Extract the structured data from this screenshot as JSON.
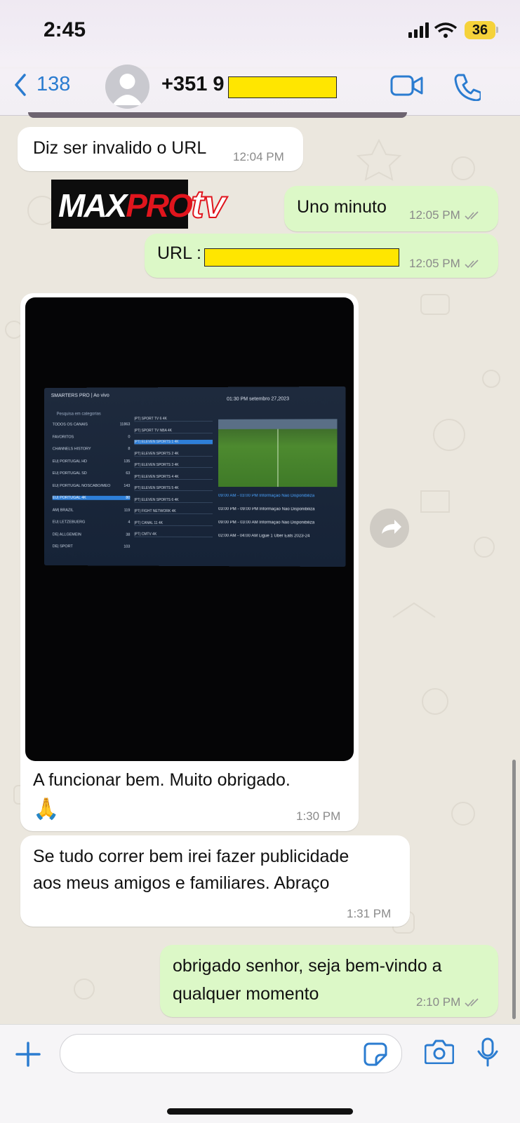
{
  "status_bar": {
    "time": "2:45",
    "battery": "36"
  },
  "header": {
    "back_count": "138",
    "contact": "+351 9"
  },
  "messages": [
    {
      "text": "Diz ser invalido o URL",
      "time": "12:04 PM"
    },
    {
      "text": "Uno minuto",
      "time": "12:05 PM"
    },
    {
      "text": "URL :",
      "time": "12:05 PM"
    },
    {
      "text": "A funcionar bem. Muito obrigado.",
      "emoji": "🙏",
      "time": "1:30 PM"
    },
    {
      "text_line1": "Se tudo correr bem irei fazer publicidade",
      "text_line2": "aos meus amigos e familiares. Abraço",
      "time": "1:31 PM"
    },
    {
      "text_line1": "obrigado senhor, seja bem-vindo a",
      "text_line2": "qualquer momento",
      "time": "2:10 PM"
    }
  ],
  "logo": {
    "brand": "MAXPRO",
    "suffix": "tv"
  },
  "photo_tv": {
    "app_title": "SMARTERS PRO | Ao vivo",
    "clock": "01:30 PM   setembro 27,2023",
    "search": "Pesquisa em categorias",
    "categories": [
      {
        "name": "TODOS OS CANAIS",
        "count": "11863"
      },
      {
        "name": "FAVORITOS",
        "count": "0"
      },
      {
        "name": "CHANNELS HISTORY",
        "count": "8"
      },
      {
        "name": "EU| PORTUGAL HD",
        "count": "135"
      },
      {
        "name": "EU| PORTUGAL SD",
        "count": "63"
      },
      {
        "name": "EU| PORTUGAL NOSCABO/MEO",
        "count": "143"
      },
      {
        "name": "EU| PORTUGAL 4K",
        "count": "80"
      },
      {
        "name": "AM| BRAZIL",
        "count": "119"
      },
      {
        "name": "EU| LETZEBUERG",
        "count": "4"
      },
      {
        "name": "DE| ALLGEMEIN",
        "count": "38"
      },
      {
        "name": "DE| SPORT",
        "count": "103"
      }
    ],
    "channels": [
      "|PT| SPORT TV 6 4K",
      "|PT| SPORT TV NBA 4K",
      "|PT| ELEVEN SPORTS 1 4K",
      "|PT| ELEVEN SPORTS 2 4K",
      "|PT| ELEVEN SPORTS 3 4K",
      "|PT| ELEVEN SPORTS 4 4K",
      "|PT| ELEVEN SPORTS 5 4K",
      "|PT| ELEVEN SPORTS 6 4K",
      "|PT| FIGHT NETWORK 4K",
      "|PT| CANAL 11 4K",
      "|PT| CMTV 4K"
    ],
    "epg": [
      "09:00 AM - 03:00 PM  Informação Não Disponibiliza",
      "03:00 PM - 09:00 PM  Informação Não Disponibiliza",
      "09:00 PM - 03:00 AM  Informação Não Disponibiliza",
      "02:00 AM - 04:00 AM  Ligue 1 Uber Eats 2023-24"
    ]
  },
  "colors": {
    "incoming": "#ffffff",
    "outgoing": "#dcf8c7",
    "link": "#2b7cd0",
    "redaction": "#ffe600"
  }
}
